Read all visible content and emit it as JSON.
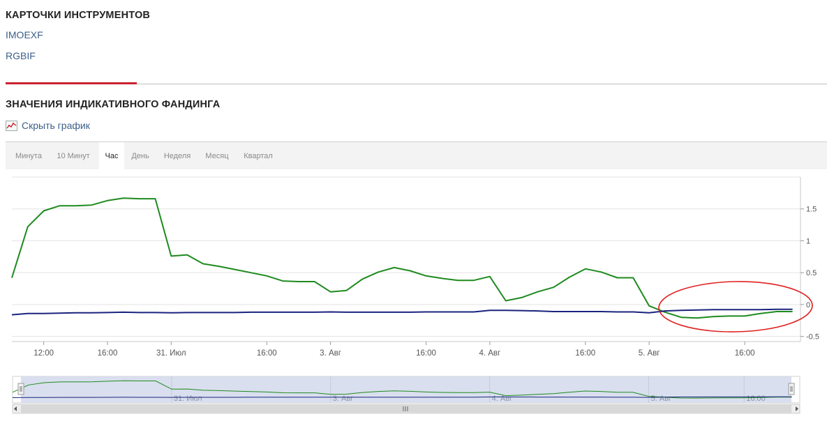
{
  "instruments": {
    "title": "КАРТОЧКИ ИНСТРУМЕНТОВ",
    "links": [
      "IMOEXF",
      "RGBIF"
    ]
  },
  "funding": {
    "title": "ЗНАЧЕНИЯ ИНДИКАТИВНОГО ФАНДИНГА",
    "hide_chart_label": "Скрыть график"
  },
  "tabs": [
    {
      "label": "Минута",
      "active": false
    },
    {
      "label": "10 Минут",
      "active": false
    },
    {
      "label": "Час",
      "active": true
    },
    {
      "label": "День",
      "active": false
    },
    {
      "label": "Неделя",
      "active": false
    },
    {
      "label": "Месяц",
      "active": false
    },
    {
      "label": "Квартал",
      "active": false
    }
  ],
  "colors": {
    "green_series": "#1e8a1e",
    "blue_series": "#1a237e",
    "annotation": "#e02020",
    "navigator_fill": "#d5dcec"
  },
  "chart_data": {
    "type": "line",
    "x_labels": [
      "12:00",
      "16:00",
      "31. Июл",
      "16:00",
      "3. Авг",
      "16:00",
      "4. Авг",
      "16:00",
      "5. Авг",
      "16:00"
    ],
    "x_label_positions": [
      2,
      6,
      10,
      16,
      20,
      26,
      30,
      36,
      40,
      46
    ],
    "y_ticks": [
      -0.5,
      0,
      0.5,
      1,
      1.5
    ],
    "y_tick_labels": [
      "-0.5",
      "0",
      "0.5",
      "1",
      "1.5"
    ],
    "ylim": [
      -0.58,
      2.0
    ],
    "xlim": [
      0,
      49.5
    ],
    "grid": true,
    "y_axis_side": "right",
    "series": [
      {
        "color": "#1e8a1e",
        "x": [
          0,
          1,
          2,
          3,
          4,
          5,
          6,
          7,
          8,
          9,
          10,
          11,
          12,
          13,
          14,
          15,
          16,
          17,
          18,
          19,
          20,
          21,
          22,
          23,
          24,
          25,
          26,
          27,
          28,
          29,
          30,
          31,
          32,
          33,
          34,
          35,
          36,
          37,
          38,
          39,
          40,
          41,
          42,
          43,
          44,
          45,
          46,
          47,
          48,
          49
        ],
        "values": [
          0.42,
          1.22,
          1.47,
          1.55,
          1.55,
          1.56,
          1.63,
          1.67,
          1.66,
          1.66,
          0.76,
          0.78,
          0.64,
          0.6,
          0.55,
          0.5,
          0.45,
          0.37,
          0.36,
          0.36,
          0.2,
          0.22,
          0.4,
          0.51,
          0.58,
          0.53,
          0.45,
          0.41,
          0.38,
          0.38,
          0.44,
          0.06,
          0.11,
          0.2,
          0.27,
          0.43,
          0.56,
          0.51,
          0.42,
          0.42,
          -0.02,
          -0.12,
          -0.2,
          -0.21,
          -0.19,
          -0.18,
          -0.18,
          -0.14,
          -0.11,
          -0.11
        ]
      },
      {
        "color": "#1a237e",
        "x": [
          0,
          1,
          2,
          3,
          4,
          5,
          6,
          7,
          8,
          9,
          10,
          11,
          12,
          13,
          14,
          15,
          16,
          17,
          18,
          19,
          20,
          21,
          22,
          23,
          24,
          25,
          26,
          27,
          28,
          29,
          30,
          31,
          32,
          33,
          34,
          35,
          36,
          37,
          38,
          39,
          40,
          41,
          42,
          43,
          44,
          45,
          46,
          47,
          48,
          49
        ],
        "values": [
          -0.16,
          -0.14,
          -0.14,
          -0.135,
          -0.13,
          -0.13,
          -0.125,
          -0.12,
          -0.125,
          -0.125,
          -0.13,
          -0.125,
          -0.125,
          -0.125,
          -0.125,
          -0.12,
          -0.12,
          -0.12,
          -0.12,
          -0.12,
          -0.115,
          -0.12,
          -0.12,
          -0.12,
          -0.12,
          -0.12,
          -0.115,
          -0.115,
          -0.115,
          -0.115,
          -0.09,
          -0.09,
          -0.095,
          -0.1,
          -0.11,
          -0.11,
          -0.11,
          -0.11,
          -0.115,
          -0.115,
          -0.13,
          -0.1,
          -0.09,
          -0.085,
          -0.08,
          -0.08,
          -0.08,
          -0.08,
          -0.075,
          -0.075
        ]
      }
    ],
    "navigator_labels": [
      "31. Июл",
      "3. Авг",
      "4. Авг",
      "5. Авг",
      "16:00"
    ]
  }
}
